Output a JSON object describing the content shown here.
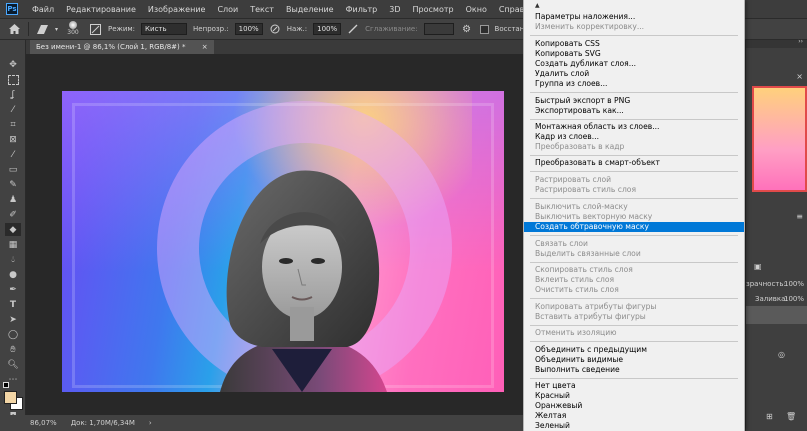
{
  "menubar": {
    "logo": "Ps",
    "items": [
      "Файл",
      "Редактирование",
      "Изображение",
      "Слои",
      "Текст",
      "Выделение",
      "Фильтр",
      "3D",
      "Просмотр",
      "Окно",
      "Справка"
    ]
  },
  "options": {
    "brush_size": "300",
    "mode_label": "Режим:",
    "mode_value": "Кисть",
    "opacity_label": "Непрозр.:",
    "opacity_value": "100%",
    "pressure_label": "Наж.:",
    "pressure_value": "100%",
    "smoothing_label": "Сглаживание:",
    "restore_label": "Восстановить истори"
  },
  "document_tab": {
    "title": "Без имени-1 @ 86,1% (Слой 1, RGB/8#) *",
    "close": "×"
  },
  "statusbar": {
    "zoom": "86,07%",
    "doc_info": "Док: 1,70M/6,34M",
    "arrow": "›"
  },
  "context_menu": {
    "scroll_up": "▲",
    "items": [
      {
        "label": "Параметры наложения...",
        "disabled": false
      },
      {
        "label": "Изменить корректировку...",
        "disabled": true
      },
      {
        "label": "Копировать CSS",
        "disabled": false
      },
      {
        "label": "Копировать SVG",
        "disabled": false
      },
      {
        "label": "Создать дубликат слоя...",
        "disabled": false
      },
      {
        "label": "Удалить слой",
        "disabled": false
      },
      {
        "label": "Группа из слоев...",
        "disabled": false
      },
      {
        "label": "Быстрый экспорт в PNG",
        "disabled": false
      },
      {
        "label": "Экспортировать как...",
        "disabled": false
      },
      {
        "label": "Монтажная область из слоев...",
        "disabled": false
      },
      {
        "label": "Кадр из слоев...",
        "disabled": false
      },
      {
        "label": "Преобразовать в кадр",
        "disabled": true
      },
      {
        "label": "Преобразовать в смарт-объект",
        "disabled": false
      },
      {
        "label": "Растрировать слой",
        "disabled": true
      },
      {
        "label": "Растрировать стиль слоя",
        "disabled": true
      },
      {
        "label": "Выключить слой-маску",
        "disabled": true
      },
      {
        "label": "Выключить векторную маску",
        "disabled": true
      },
      {
        "label": "Создать обтравочную маску",
        "disabled": false,
        "highlighted": true
      },
      {
        "label": "Связать слои",
        "disabled": true
      },
      {
        "label": "Выделить связанные слои",
        "disabled": true
      },
      {
        "label": "Скопировать стиль слоя",
        "disabled": true
      },
      {
        "label": "Вклеить стиль слоя",
        "disabled": true
      },
      {
        "label": "Очистить стиль слоя",
        "disabled": true
      },
      {
        "label": "Копировать атрибуты фигуры",
        "disabled": true
      },
      {
        "label": "Вставить атрибуты фигуры",
        "disabled": true
      },
      {
        "label": "Отменить изоляцию",
        "disabled": true
      },
      {
        "label": "Объединить с предыдущим",
        "disabled": false
      },
      {
        "label": "Объединить видимые",
        "disabled": false
      },
      {
        "label": "Выполнить сведение",
        "disabled": false
      },
      {
        "label": "Нет цвета",
        "disabled": false
      },
      {
        "label": "Красный",
        "disabled": false
      },
      {
        "label": "Оранжевый",
        "disabled": false
      },
      {
        "label": "Желтая",
        "disabled": false
      },
      {
        "label": "Зеленый",
        "disabled": false
      }
    ]
  },
  "right_panel": {
    "opacity_label": "зрачность:",
    "opacity_value": "100%",
    "fill_label": "Заливка:",
    "fill_value": "100%"
  },
  "colors": {
    "highlight": "#0078d7",
    "menu_bg": "#f0f0f0",
    "ui_dark": "#424242"
  }
}
